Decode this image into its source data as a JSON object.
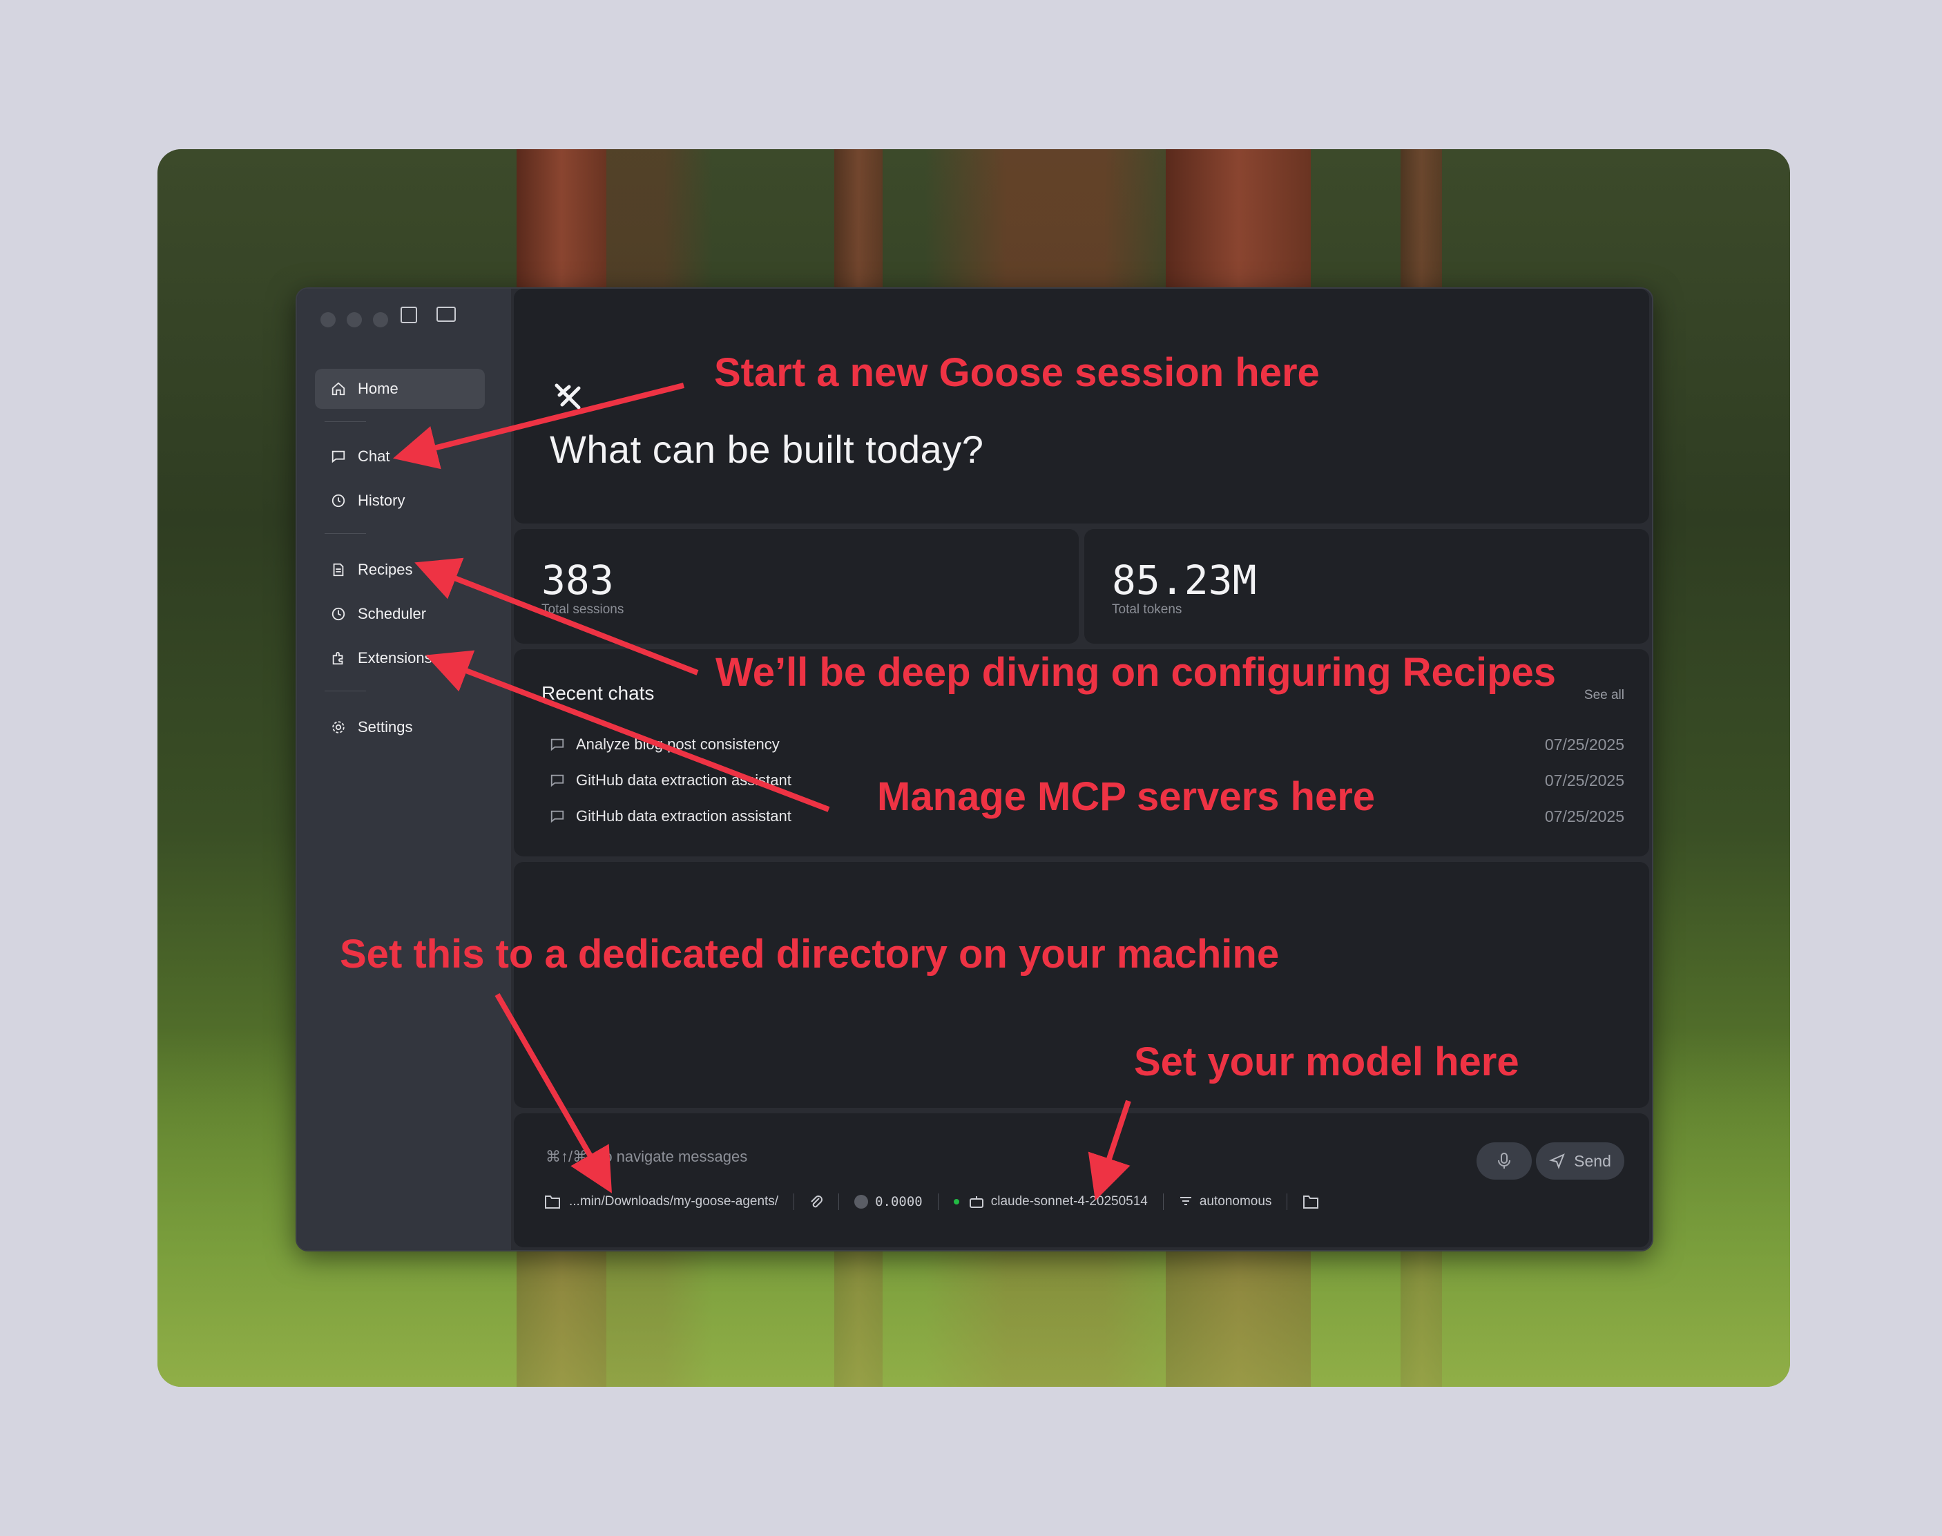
{
  "sidebar": {
    "items": [
      {
        "label": "Home",
        "icon": "home-icon"
      },
      {
        "label": "Chat",
        "icon": "chat-icon"
      },
      {
        "label": "History",
        "icon": "history-icon"
      },
      {
        "label": "Recipes",
        "icon": "recipes-icon"
      },
      {
        "label": "Scheduler",
        "icon": "clock-icon"
      },
      {
        "label": "Extensions",
        "icon": "puzzle-icon"
      },
      {
        "label": "Settings",
        "icon": "gear-icon"
      }
    ],
    "active": "Home"
  },
  "hero": {
    "title": "What can be built today?"
  },
  "stats": {
    "sessions": {
      "value": "383",
      "label": "Total sessions"
    },
    "tokens": {
      "value": "85.23M",
      "label": "Total tokens"
    }
  },
  "recent": {
    "title": "Recent chats",
    "see_all": "See all",
    "chats": [
      {
        "title": "Analyze blog post consistency",
        "date": "07/25/2025"
      },
      {
        "title": "GitHub data extraction assistant",
        "date": "07/25/2025"
      },
      {
        "title": "GitHub data extraction assistant",
        "date": "07/25/2025"
      }
    ]
  },
  "input": {
    "hint": "⌘↑/⌘↓ to navigate messages",
    "send_label": "Send",
    "directory": "...min/Downloads/my-goose-agents/",
    "cost": "0.0000",
    "model": "claude-sonnet-4-20250514",
    "mode": "autonomous"
  },
  "annotations": {
    "new_session": "Start a new Goose session here",
    "recipes": "We’ll be deep diving on configuring Recipes",
    "mcp": "Manage MCP servers here",
    "directory": "Set this to a dedicated directory on your machine",
    "model": "Set your model here"
  },
  "colors": {
    "annotation": "#ee3344",
    "background": "#d5d5e0",
    "window": "#23252b",
    "sidebar": "#33363e"
  }
}
